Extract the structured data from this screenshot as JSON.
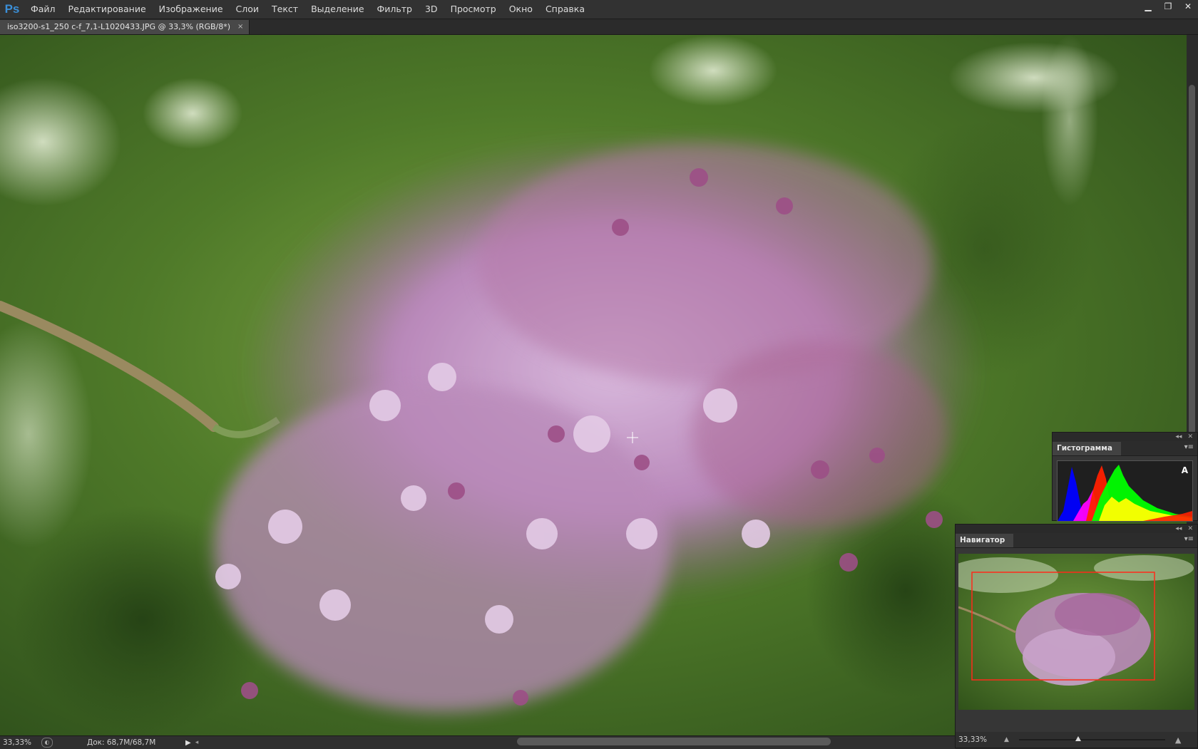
{
  "app": {
    "logo": "Ps"
  },
  "menu": [
    "Файл",
    "Редактирование",
    "Изображение",
    "Слои",
    "Текст",
    "Выделение",
    "Фильтр",
    "3D",
    "Просмотр",
    "Окно",
    "Справка"
  ],
  "window_controls": {
    "minimize": "▁",
    "restore": "❐",
    "close": "✕"
  },
  "document_tab": {
    "title": "iso3200-s1_250 c-f_7,1-L1020433.JPG @ 33,3% (RGB/8*)",
    "close": "×"
  },
  "status": {
    "zoom": "33,33%",
    "doc_size": "Док: 68,7M/68,7M",
    "menu_arrow": "▶",
    "scroll_left": "◂"
  },
  "panels": {
    "histogram": {
      "title": "Гистограмма",
      "warning_icon": "A",
      "menu_icon": "▾≡"
    },
    "navigator": {
      "title": "Навигатор",
      "zoom": "33,33%",
      "menu_icon": "▾≡",
      "zoom_out_icon": "mountain-small-icon",
      "zoom_in_icon": "mountain-large-icon",
      "zoom_slider_fraction": 0.405
    }
  },
  "panel_controls": {
    "collapse": "◂◂",
    "close": "✕"
  },
  "colors": {
    "menubar": "#323232",
    "canvas_bg": "#5a7d33",
    "nav_frame": "#ff2a1a",
    "ps_blue": "#3b8fd8"
  }
}
